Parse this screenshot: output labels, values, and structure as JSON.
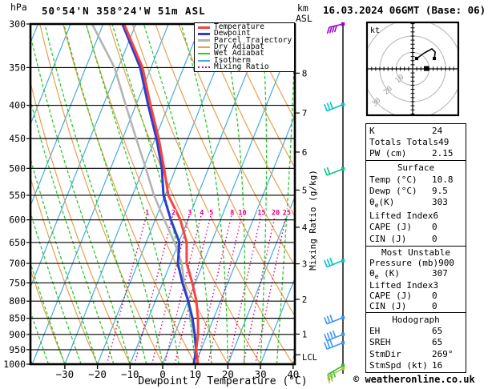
{
  "header": {
    "station": "50°54'N 358°24'W 51m ASL",
    "datetime": "16.03.2024 06GMT (Base: 06)"
  },
  "labels": {
    "pressure_unit": "hPa",
    "km": "km",
    "asl": "ASL",
    "lcl": "LCL",
    "xaxis": "Dewpoint / Temperature (°C)",
    "mixing_axis": "Mixing Ratio (g/kg)",
    "hodo_unit": "kt"
  },
  "colors": {
    "temperature": "#f8423f",
    "dewpoint": "#2840cc",
    "parcel": "#b4b4b4",
    "dry_adiabat": "#e8a04e",
    "wet_adiabat": "#2ec82e",
    "isotherm": "#46abe0",
    "mixing_ratio": "#e0007d",
    "grid": "#000000",
    "hodo_ring": "#b8b8b8",
    "hodo_ring_label": "#a0a0a0"
  },
  "legend": {
    "items": [
      {
        "label": "Temperature",
        "color": "#f8423f",
        "style": "thick"
      },
      {
        "label": "Dewpoint",
        "color": "#2840cc",
        "style": "thick"
      },
      {
        "label": "Parcel Trajectory",
        "color": "#b4b4b4",
        "style": "thick"
      },
      {
        "label": "Dry Adiabat",
        "color": "#e8a04e",
        "style": "thin"
      },
      {
        "label": "Wet Adiabat",
        "color": "#2ec82e",
        "style": "thin"
      },
      {
        "label": "Isotherm",
        "color": "#46abe0",
        "style": "thin"
      },
      {
        "label": "Mixing Ratio",
        "color": "#e0007d",
        "style": "dotted"
      }
    ]
  },
  "chart_data": {
    "type": "skewt_log_p_sounding",
    "pressure_axis": {
      "unit": "hPa",
      "range": [
        300,
        1000
      ],
      "ticks": [
        300,
        350,
        400,
        450,
        500,
        550,
        600,
        650,
        700,
        750,
        800,
        850,
        900,
        950,
        1000
      ]
    },
    "temp_axis": {
      "unit": "°C",
      "range_at_surface": [
        -35,
        41
      ],
      "ticks": [
        -30,
        -20,
        -10,
        0,
        10,
        20,
        30,
        40
      ]
    },
    "km_axis": {
      "unit": "km",
      "ref": "ASL",
      "ticks": [
        {
          "km": 8,
          "pressure": 357
        },
        {
          "km": 7,
          "pressure": 411
        },
        {
          "km": 6,
          "pressure": 472
        },
        {
          "km": 5,
          "pressure": 540
        },
        {
          "km": 4,
          "pressure": 616
        },
        {
          "km": 3,
          "pressure": 701
        },
        {
          "km": 2,
          "pressure": 795
        },
        {
          "km": 1,
          "pressure": 899
        }
      ],
      "lcl_pressure": 967
    },
    "isotherms": {
      "start": -80,
      "end": 40,
      "step": 10
    },
    "dry_adiabats": {
      "start": -40,
      "end": 130,
      "step": 10
    },
    "wet_adiabats": {
      "start": -40,
      "end": 40,
      "step": 5
    },
    "mixing_ratio_lines": {
      "values": [
        1,
        2,
        3,
        4,
        5,
        8,
        10,
        15,
        20,
        25
      ],
      "bottom_pressure": 1000,
      "top_pressure": 570,
      "label_pressure": 585
    },
    "sounding": {
      "pressure": [
        300,
        350,
        400,
        450,
        500,
        550,
        600,
        650,
        700,
        750,
        800,
        850,
        900,
        950,
        1000
      ],
      "temperature": [
        -53.6,
        -42.6,
        -35.5,
        -28.9,
        -23.6,
        -19.0,
        -12.3,
        -7.6,
        -5.0,
        -0.9,
        2.6,
        5.2,
        7.2,
        8.5,
        10.8
      ],
      "dewpoint": [
        -54.1,
        -43.3,
        -36.2,
        -29.6,
        -24.3,
        -20.5,
        -15.2,
        -9.8,
        -7.7,
        -3.9,
        0.1,
        3.5,
        6.2,
        8.5,
        9.5
      ],
      "parcel": [
        -63.4,
        -51.2,
        -43.1,
        -35.8,
        -29.2,
        -23.4,
        -17.2,
        -11.3,
        -6.5,
        -3.4,
        0.1,
        3.0,
        5.9,
        8.5,
        10.6
      ]
    },
    "wind_barbs": [
      {
        "pressure": 300,
        "color": "#9b00d8",
        "ticks": 4,
        "style": "top"
      },
      {
        "pressure": 399,
        "color": "#00c6c6",
        "ticks": 3,
        "style": "normal"
      },
      {
        "pressure": 501,
        "color": "#00ca85",
        "ticks": 2,
        "style": "normal"
      },
      {
        "pressure": 693,
        "color": "#00c6c6",
        "ticks": 3,
        "style": "normal"
      },
      {
        "pressure": 848,
        "color": "#3b97f5",
        "ticks": 3,
        "style": "normal"
      },
      {
        "pressure": 900,
        "color": "#3b97f5",
        "ticks": 4,
        "style": "normal"
      },
      {
        "pressure": 927,
        "color": "#3b97f5",
        "ticks": 3,
        "style": "normal"
      },
      {
        "pressure": 1005,
        "color": "#35b33c",
        "ticks": 3,
        "style": "below"
      },
      {
        "pressure": 1015,
        "color": "#a8c832",
        "ticks": 2,
        "style": "below"
      }
    ]
  },
  "hodograph": {
    "unit": "kt",
    "rings_kt": [
      10,
      20,
      30
    ],
    "trace_kt": [
      [
        2.4,
        6.3
      ],
      [
        7.3,
        9.8
      ],
      [
        11.7,
        12.2
      ],
      [
        13.7,
        10.2
      ],
      [
        13.2,
        6.3
      ]
    ],
    "trace_dots_kt": [
      [
        2.4,
        6.3
      ],
      [
        13.2,
        6.3
      ]
    ],
    "storm_motion_kt": [
      8.3,
      0.2
    ]
  },
  "stats": {
    "indices": {
      "rows": [
        [
          "K",
          "24"
        ],
        [
          "Totals Totals",
          "49"
        ],
        [
          "PW (cm)",
          "2.15"
        ]
      ]
    },
    "surface": {
      "title": "Surface",
      "rows": [
        [
          "Temp (°C)",
          "10.8"
        ],
        [
          "Dewp (°C)",
          "9.5"
        ],
        [
          "θe(K)",
          "303"
        ],
        [
          "Lifted Index",
          "6"
        ],
        [
          "CAPE (J)",
          "0"
        ],
        [
          "CIN (J)",
          "0"
        ]
      ]
    },
    "most_unstable": {
      "title": "Most Unstable",
      "rows": [
        [
          "Pressure (mb)",
          "900"
        ],
        [
          "θe (K)",
          "307"
        ],
        [
          "Lifted Index",
          "3"
        ],
        [
          "CAPE (J)",
          "0"
        ],
        [
          "CIN (J)",
          "0"
        ]
      ]
    },
    "hodograph": {
      "title": "Hodograph",
      "rows": [
        [
          "EH",
          "65"
        ],
        [
          "SREH",
          "65"
        ],
        [
          "StmDir",
          "269°"
        ],
        [
          "StmSpd (kt)",
          "16"
        ]
      ]
    }
  },
  "footer": {
    "copyright": "© weatheronline.co.uk"
  }
}
